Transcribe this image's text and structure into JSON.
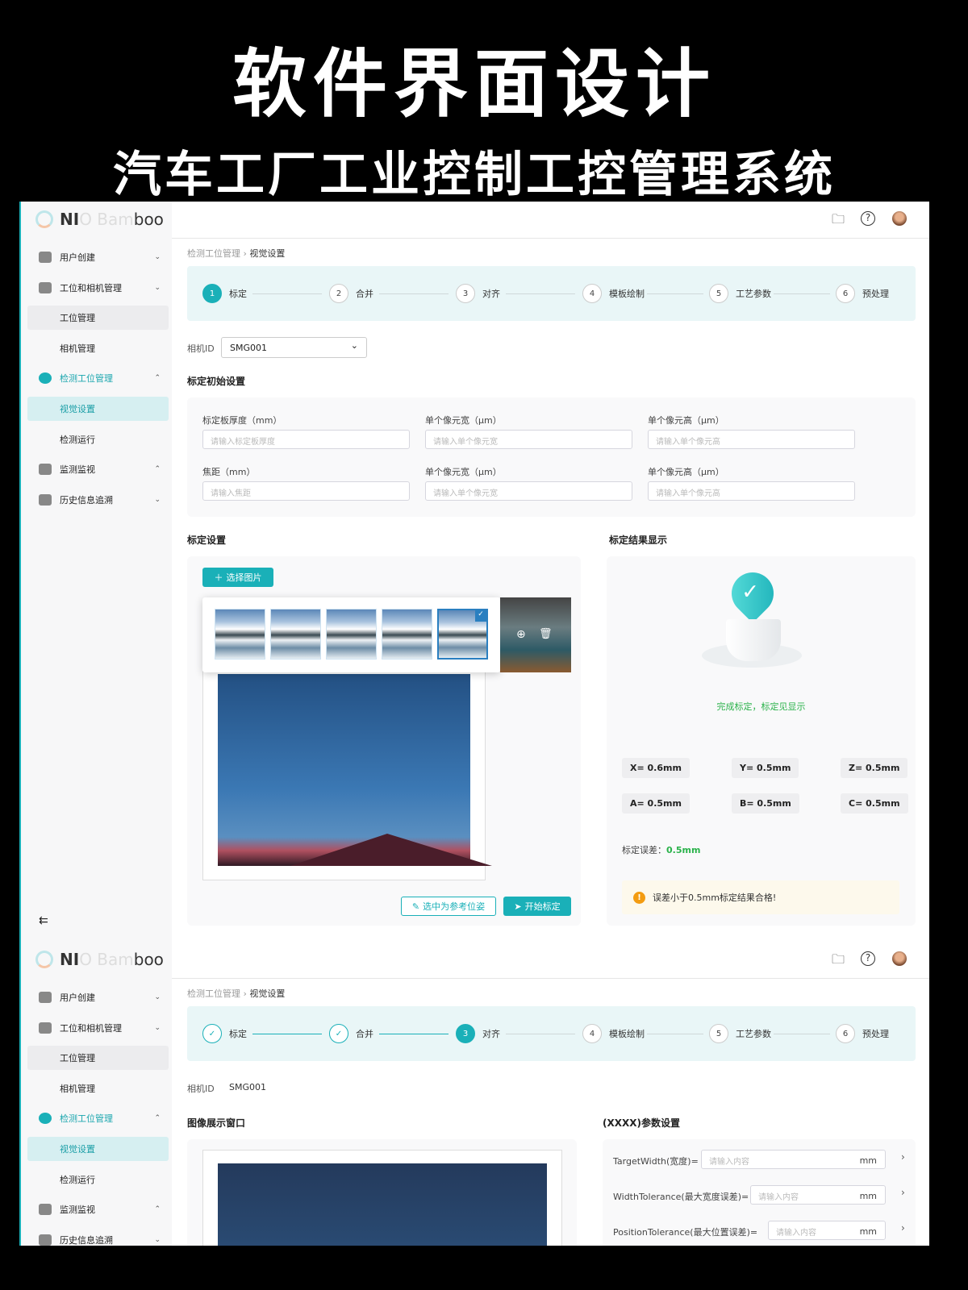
{
  "banner": {
    "title": "软件界面设计",
    "subtitle": "汽车工厂工业控制工控管理系统"
  },
  "colors": {
    "accent": "#1ab0b8",
    "success": "#2ab24a",
    "warning": "#f39c12"
  },
  "logo": {
    "text_dark": "NI",
    "text_fade": "O Bam",
    "text_end": "boo"
  },
  "topbar": {
    "icons": [
      "folder-icon",
      "help-icon",
      "user-avatar"
    ]
  },
  "sidebar": {
    "items": [
      {
        "label": "用户创建",
        "icon": "user-icon",
        "chevron": "⌄",
        "type": "group"
      },
      {
        "label": "工位和相机管理",
        "icon": "camera-icon",
        "chevron": "⌄",
        "type": "group"
      },
      {
        "label": "工位管理",
        "type": "sub",
        "state": "selected"
      },
      {
        "label": "相机管理",
        "type": "sub"
      },
      {
        "label": "检测工位管理",
        "icon": "inspection-icon",
        "chevron": "⌃",
        "type": "group",
        "state": "open"
      },
      {
        "label": "视觉设置",
        "type": "sub",
        "state": "active"
      },
      {
        "label": "检测运行",
        "type": "sub"
      },
      {
        "label": "监测监视",
        "icon": "monitor-icon",
        "chevron": "⌃",
        "type": "group"
      },
      {
        "label": "历史信息追溯",
        "icon": "calendar-icon",
        "chevron": "⌄",
        "type": "group"
      }
    ],
    "collapse_icon": "⇇"
  },
  "breadcrumb": {
    "parent": "检测工位管理",
    "sep": "›",
    "current": "视觉设置"
  },
  "steps": [
    {
      "n": "1",
      "label": "标定"
    },
    {
      "n": "2",
      "label": "合并"
    },
    {
      "n": "3",
      "label": "对齐"
    },
    {
      "n": "4",
      "label": "模板绘制"
    },
    {
      "n": "5",
      "label": "工艺参数"
    },
    {
      "n": "6",
      "label": "预处理"
    }
  ],
  "screen1": {
    "active_step": 1,
    "camera_label": "相机ID",
    "camera_value": "SMG001",
    "init_title": "标定初始设置",
    "fields": [
      {
        "label": "标定板厚度（mm）",
        "placeholder": "请输入标定板厚度"
      },
      {
        "label": "单个像元宽（μm）",
        "placeholder": "请输入单个像元宽"
      },
      {
        "label": "单个像元高（μm）",
        "placeholder": "请输入单个像元高"
      },
      {
        "label": "焦距（mm）",
        "placeholder": "请输入焦距"
      },
      {
        "label": "单个像元宽（μm）",
        "placeholder": "请输入单个像元宽"
      },
      {
        "label": "单个像元高（μm）",
        "placeholder": "请输入单个像元高"
      }
    ],
    "calib_title": "标定设置",
    "select_image": "选择图片",
    "thumb_count": 5,
    "selected_thumb": 5,
    "set_reference": "选中为参考位姿",
    "start_calib": "开始标定",
    "result_title": "标定结果显示",
    "result_message": "完成标定，标定见显示",
    "values": [
      "X=  0.6mm",
      "Y=  0.5mm",
      "Z=  0.5mm",
      "A=  0.5mm",
      "B=  0.5mm",
      "C=  0.5mm"
    ],
    "error_label": "标定误差：",
    "error_value": "0.5mm",
    "alert": "误差小于0.5mm标定结果合格!"
  },
  "screen2": {
    "active_step": 3,
    "camera_label": "相机ID",
    "camera_value": "SMG001",
    "image_title": "图像展示窗口",
    "params_title": "(XXXX)参数设置",
    "params": [
      {
        "label": "TargetWidth(宽度)=",
        "placeholder": "请输入内容",
        "unit": "mm"
      },
      {
        "label": "WidthTolerance(最大宽度误差)=",
        "placeholder": "请输入内容",
        "unit": "mm"
      },
      {
        "label": "PositionTolerance(最大位置误差)=",
        "placeholder": "请输入内容",
        "unit": "mm"
      }
    ]
  }
}
